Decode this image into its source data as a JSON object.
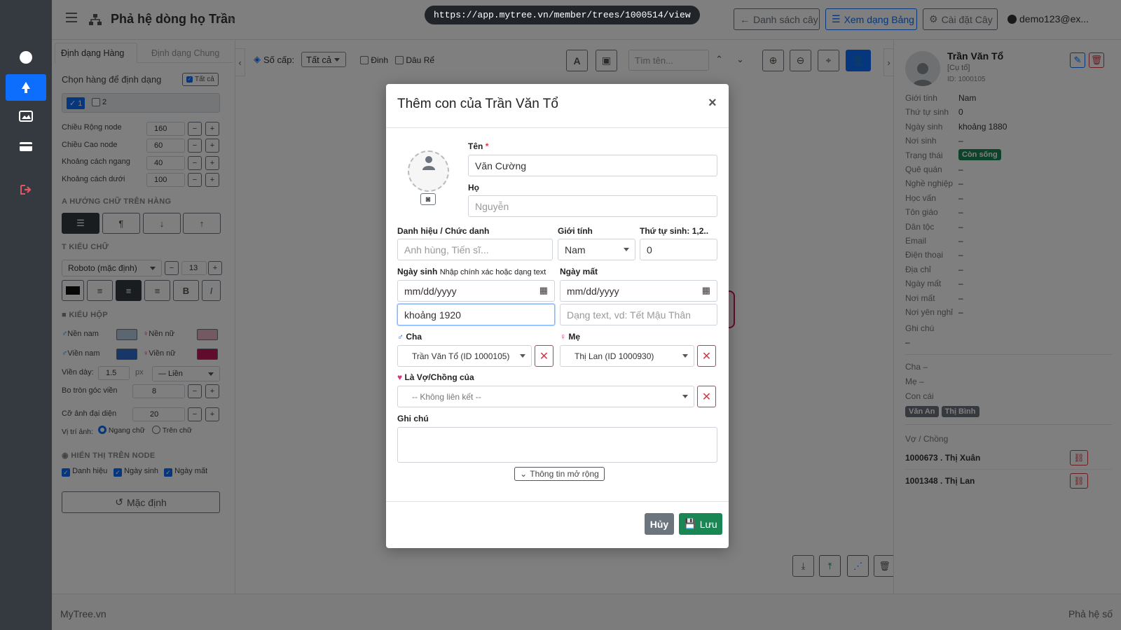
{
  "url": "https://app.mytree.vn/member/trees/1000514/view",
  "header": {
    "title": "Phả hệ dòng họ Trần",
    "btn_tree_list": "Danh sách cây",
    "btn_table_view": "Xem dạng Bảng",
    "btn_tree_settings": "Cài đặt Cây",
    "user": "demo123@ex..."
  },
  "left_panel": {
    "tab_row": "Định dạng Hàng",
    "tab_general": "Định dạng Chung",
    "choose_row": "Chọn hàng để định dạng",
    "all_btn": "Tất cả",
    "row1": "1",
    "row2": "2",
    "node_width_label": "Chiều Rộng node",
    "node_width": "160",
    "node_height_label": "Chiều Cao node",
    "node_height": "60",
    "h_gap_label": "Khoảng cách ngang",
    "h_gap": "40",
    "v_gap_label": "Khoảng cách dưới",
    "v_gap": "100",
    "text_dir_section": "Hướng chữ trên hàng",
    "font_section": "Kiểu chữ",
    "font_family": "Roboto (mặc định)",
    "font_size": "13",
    "bold": "B",
    "italic": "I",
    "box_section": "Kiểu hộp",
    "male_bg": "Nền nam",
    "female_bg": "Nền nữ",
    "male_border": "Viền nam",
    "female_border": "Viền nữ",
    "border_width_label": "Viền dày:",
    "border_width": "1.5",
    "border_unit": "px",
    "border_style": "— Liền",
    "radius_label": "Bo tròn góc viền",
    "radius": "8",
    "avatar_size_label": "Cỡ ảnh đại diện",
    "avatar_size": "20",
    "img_pos_label": "Vị trí ảnh:",
    "img_pos_opt1": "Ngang chữ",
    "img_pos_opt2": "Trên chữ",
    "show_section": "Hiển thị trên node",
    "show_title": "Danh hiệu",
    "show_birth": "Ngày sinh",
    "show_death": "Ngày mất",
    "reset_btn": "Mặc định",
    "colors": {
      "male_bg": "#b8cde0",
      "female_bg": "#e6b3c3",
      "male_border": "#2f6fd1",
      "female_border": "#c2185b"
    }
  },
  "canvas_toolbar": {
    "level_label": "Số cấp:",
    "level_value": "Tất cả",
    "opt_dinh": "Đinh",
    "opt_daure": "Dâu Rể",
    "search_placeholder": "Tìm tên..."
  },
  "right_panel": {
    "name": "Trần Văn Tổ",
    "title": "[Cụ tổ]",
    "id": "ID: 1000105",
    "fields": [
      {
        "k": "Giới tính",
        "v": "Nam"
      },
      {
        "k": "Thứ tự sinh",
        "v": "0"
      },
      {
        "k": "Ngày sinh",
        "v": "khoảng 1880"
      },
      {
        "k": "Nơi sinh",
        "v": "–"
      },
      {
        "k": "Trạng thái",
        "v": "Còn sống"
      },
      {
        "k": "Quê quán",
        "v": "–"
      },
      {
        "k": "Nghề nghiệp",
        "v": "–"
      },
      {
        "k": "Học vấn",
        "v": "–"
      },
      {
        "k": "Tôn giáo",
        "v": "–"
      },
      {
        "k": "Dân tộc",
        "v": "–"
      },
      {
        "k": "Email",
        "v": "–"
      },
      {
        "k": "Điện thoại",
        "v": "–"
      },
      {
        "k": "Địa chỉ",
        "v": "–"
      },
      {
        "k": "Ngày mất",
        "v": "–"
      },
      {
        "k": "Nơi mất",
        "v": "–"
      },
      {
        "k": "Nơi yên nghỉ",
        "v": "–"
      }
    ],
    "note_label": "Ghi chú",
    "note_value": "–",
    "father_label": "Cha",
    "father_value": "–",
    "mother_label": "Mẹ",
    "mother_value": "–",
    "children_label": "Con cái",
    "children": [
      "Văn An",
      "Thị Bình"
    ],
    "spouses_label": "Vợ / Chồng",
    "spouses": [
      "1000673 . Thị Xuân",
      "1001348 . Thị Lan"
    ]
  },
  "footer": {
    "left": "MyTree.vn",
    "right": "Phả hệ số"
  },
  "modal": {
    "title": "Thêm con của Trần Văn Tổ",
    "name_label": "Tên",
    "required_mark": "*",
    "name_value": "Văn Cường",
    "surname_label": "Họ",
    "surname_placeholder": "Nguyễn",
    "honor_label": "Danh hiệu / Chức danh",
    "honor_placeholder": "Anh hùng, Tiến sĩ...",
    "gender_label": "Giới tính",
    "gender_value": "Nam",
    "order_label": "Thứ tự sinh: 1,2..",
    "order_value": "0",
    "birth_label": "Ngày sinh",
    "birth_hint": "Nhập chính xác hoặc dạng text",
    "birth_date": "mm/dd/yyyy",
    "birth_text": "khoảng 1920",
    "death_label": "Ngày mất",
    "death_date": "mm/dd/yyyy",
    "death_placeholder": "Dạng text, vd: Tết Mậu Thân",
    "father_label": "Cha",
    "father_value": "Trần Văn Tổ (ID 1000105)",
    "mother_label": "Mẹ",
    "mother_value": "Thị Lan (ID 1000930)",
    "spouse_label": "Là Vợ/Chồng của",
    "spouse_value": "-- Không liên kết --",
    "note_label": "Ghi chú",
    "expand_btn": "Thông tin mở rộng",
    "cancel": "Hủy",
    "save": "Lưu"
  },
  "theme": {
    "primary": "#0d6efd",
    "success": "#198754",
    "danger": "#dc3545",
    "dark": "#343a40"
  }
}
